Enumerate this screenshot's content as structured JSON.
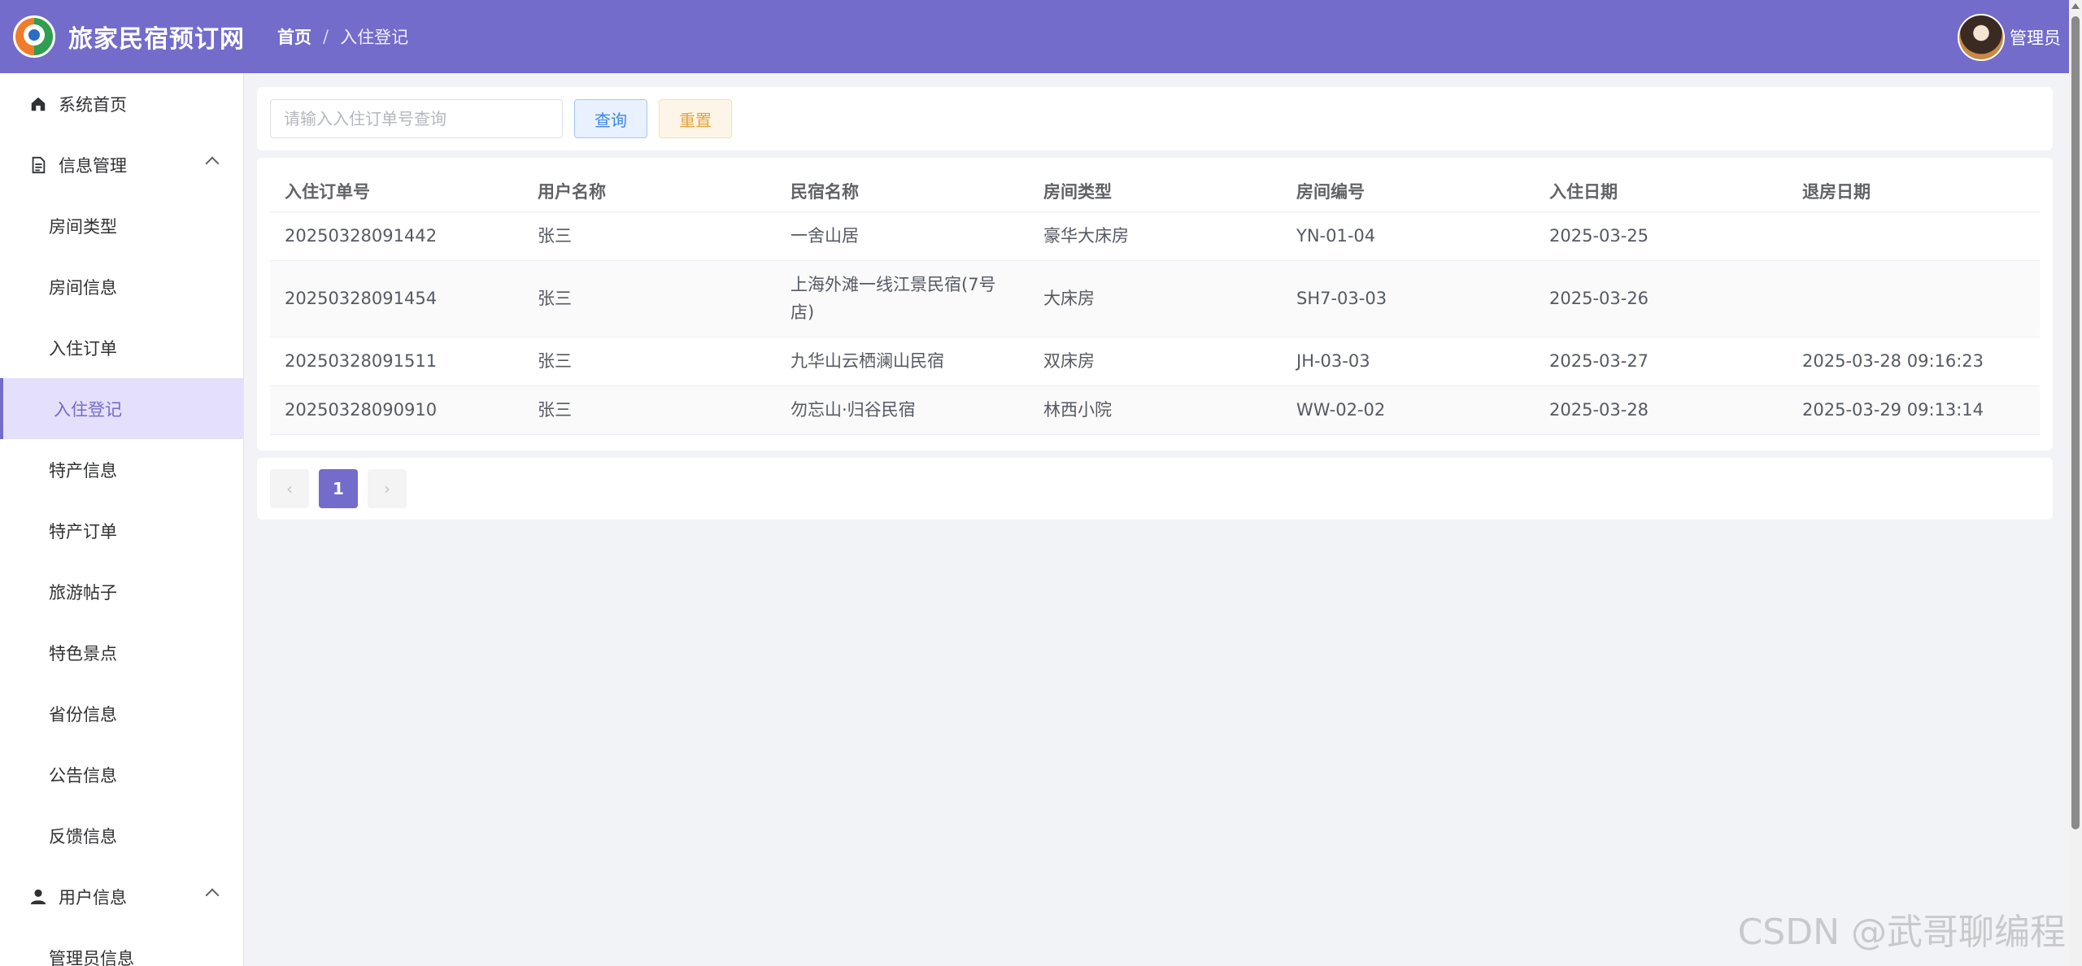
{
  "header": {
    "site_title": "旅家民宿预订网",
    "breadcrumb_home": "首页",
    "breadcrumb_separator": "/",
    "breadcrumb_current": "入住登记",
    "user_name": "管理员",
    "bg_color": "#736ccb"
  },
  "sidebar": {
    "items": [
      {
        "label": "系统首页",
        "icon": "home-icon"
      },
      {
        "label": "信息管理",
        "icon": "document-icon"
      },
      {
        "label": "房间类型"
      },
      {
        "label": "房间信息"
      },
      {
        "label": "入住订单"
      },
      {
        "label": "入住登记"
      },
      {
        "label": "特产信息"
      },
      {
        "label": "特产订单"
      },
      {
        "label": "旅游帖子"
      },
      {
        "label": "特色景点"
      },
      {
        "label": "省份信息"
      },
      {
        "label": "公告信息"
      },
      {
        "label": "反馈信息"
      },
      {
        "label": "用户信息",
        "icon": "user-icon"
      },
      {
        "label": "管理员信息"
      }
    ]
  },
  "search": {
    "placeholder": "请输入入住订单号查询",
    "query_label": "查询",
    "reset_label": "重置"
  },
  "table": {
    "columns": [
      "入住订单号",
      "用户名称",
      "民宿名称",
      "房间类型",
      "房间编号",
      "入住日期",
      "退房日期"
    ],
    "rows": [
      [
        "20250328091442",
        "张三",
        "一舍山居",
        "豪华大床房",
        "YN-01-04",
        "2025-03-25",
        ""
      ],
      [
        "20250328091454",
        "张三",
        "上海外滩一线江景民宿(7号店)",
        "大床房",
        "SH7-03-03",
        "2025-03-26",
        ""
      ],
      [
        "20250328091511",
        "张三",
        "九华山云栖澜山民宿",
        "双床房",
        "JH-03-03",
        "2025-03-27",
        "2025-03-28 09:16:23"
      ],
      [
        "20250328090910",
        "张三",
        "勿忘山·归谷民宿",
        "林西小院",
        "WW-02-02",
        "2025-03-28",
        "2025-03-29 09:13:14"
      ]
    ]
  },
  "pagination": {
    "prev": "‹",
    "current_page": "1",
    "next": "›"
  },
  "watermark": "CSDN @武哥聊编程"
}
